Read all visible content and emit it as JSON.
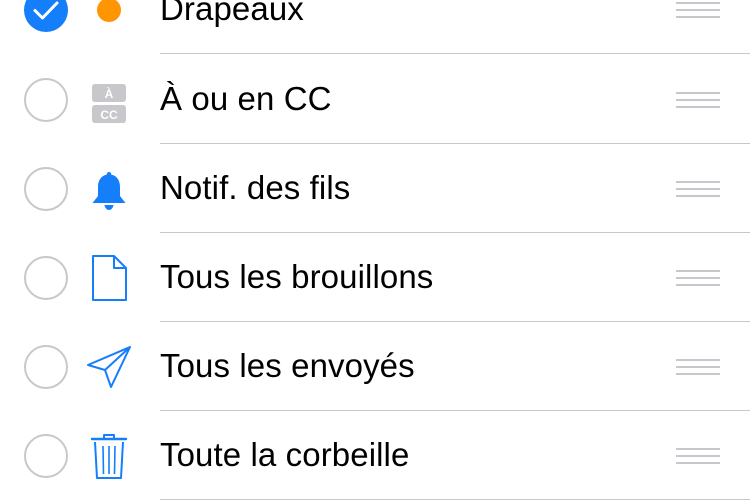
{
  "accent_color": "#157efb",
  "items": [
    {
      "label": "Drapeaux",
      "checked": true,
      "icon": "orange-dot-icon"
    },
    {
      "label": "À ou en CC",
      "checked": false,
      "icon": "to-cc-icon",
      "badge_top": "À",
      "badge_bottom": "CC"
    },
    {
      "label": "Notif. des fils",
      "checked": false,
      "icon": "bell-icon"
    },
    {
      "label": "Tous les brouillons",
      "checked": false,
      "icon": "document-icon"
    },
    {
      "label": "Tous les envoyés",
      "checked": false,
      "icon": "paper-plane-icon"
    },
    {
      "label": "Toute la corbeille",
      "checked": false,
      "icon": "trash-icon"
    }
  ]
}
